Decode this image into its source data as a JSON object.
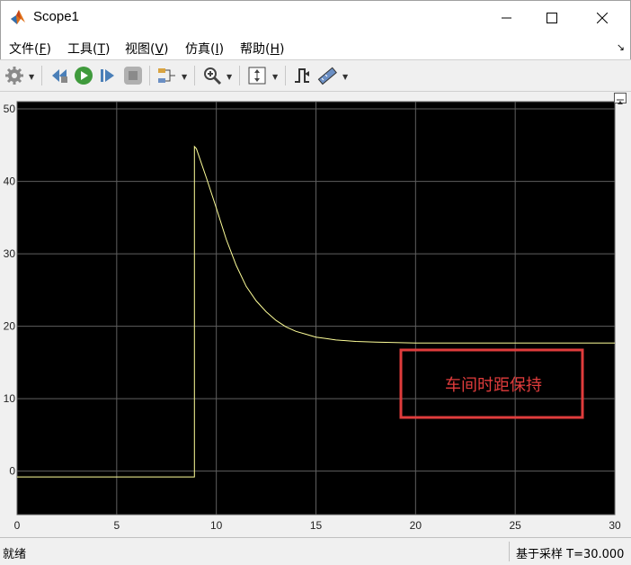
{
  "window": {
    "title": "Scope1"
  },
  "menu": {
    "items": [
      {
        "label": "文件(",
        "key": "F",
        "tail": ")"
      },
      {
        "label": "工具(",
        "key": "T",
        "tail": ")"
      },
      {
        "label": "视图(",
        "key": "V",
        "tail": ")"
      },
      {
        "label": "仿真(",
        "key": "I",
        "tail": ")"
      },
      {
        "label": "帮助(",
        "key": "H",
        "tail": ")"
      }
    ]
  },
  "toolbar": {
    "icons": [
      "settings-gear-icon",
      "step-back-icon",
      "run-icon",
      "step-forward-icon",
      "stop-icon",
      "signal-selector-icon",
      "zoom-in-icon",
      "autoscale-icon",
      "trigger-icon",
      "measure-icon"
    ]
  },
  "colors": {
    "plot_bg": "#000000",
    "grid": "#5f5f5f",
    "trace": "#ffff99",
    "annotation": "#e03c3c",
    "tick_label": "#bdbdbd"
  },
  "chart_data": {
    "type": "line",
    "title": "",
    "xlabel": "",
    "ylabel": "",
    "xlim": [
      0,
      30
    ],
    "ylim": [
      -6,
      51
    ],
    "xticks": [
      0,
      5,
      10,
      15,
      20,
      25,
      30
    ],
    "yticks": [
      0,
      10,
      20,
      30,
      40,
      50
    ],
    "xtick_labels": [
      "0",
      "5",
      "10",
      "15",
      "20",
      "25",
      "30"
    ],
    "ytick_labels": [
      "0",
      "10",
      "20",
      "30",
      "40",
      "50"
    ],
    "grid": true,
    "series": [
      {
        "x": [
          0,
          8.9,
          8.9,
          9.0,
          9.5,
          10.0,
          10.5,
          11.0,
          11.5,
          12.0,
          12.5,
          13.0,
          13.5,
          14.0,
          14.5,
          15.0,
          15.5,
          16.0,
          17.0,
          18.0,
          20.0,
          22.0,
          25.0,
          30.0
        ],
        "y": [
          -0.8,
          -0.8,
          44.8,
          44.5,
          40.5,
          36.3,
          32.0,
          28.4,
          25.5,
          23.5,
          22.0,
          20.8,
          19.9,
          19.3,
          18.9,
          18.5,
          18.3,
          18.1,
          17.9,
          17.8,
          17.7,
          17.7,
          17.7,
          17.7
        ]
      }
    ],
    "annotation": "车间时距保持"
  },
  "status": {
    "left": "就绪",
    "right": "基于采样  T=30.000"
  }
}
